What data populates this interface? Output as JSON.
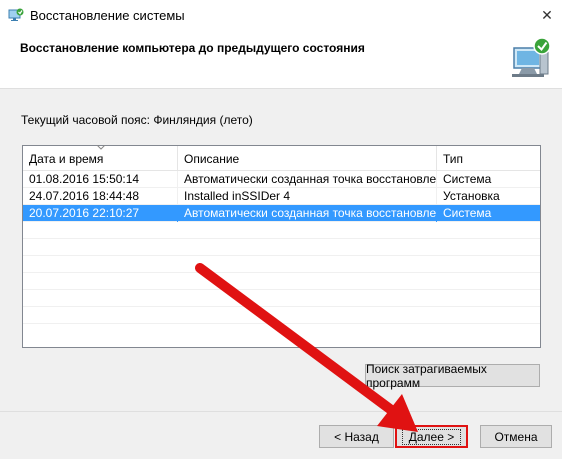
{
  "window": {
    "title": "Восстановление системы",
    "icon": "system-restore-icon",
    "close_glyph": "✕"
  },
  "header": {
    "heading": "Восстановление компьютера до предыдущего состояния",
    "art_icon": "computer-restore-icon"
  },
  "timezone_text": "Текущий часовой пояс: Финляндия (лето)",
  "table": {
    "columns": [
      "Дата и время",
      "Описание",
      "Тип"
    ],
    "sort_column": "Дата и время",
    "rows": [
      {
        "date": "01.08.2016 15:50:14",
        "description": "Автоматически созданная точка восстановле...",
        "type": "Система",
        "selected": false
      },
      {
        "date": "24.07.2016 18:44:48",
        "description": "Installed inSSIDer 4",
        "type": "Установка",
        "selected": false
      },
      {
        "date": "20.07.2016 22:10:27",
        "description": "Автоматически созданная точка восстановле...",
        "type": "Система",
        "selected": true
      }
    ]
  },
  "buttons": {
    "scan_affected": "Поиск затрагиваемых программ",
    "back": "< Назад",
    "next": "Далее >",
    "cancel": "Отмена"
  },
  "colors": {
    "selection": "#3399ff",
    "annotation": "#e01212"
  }
}
